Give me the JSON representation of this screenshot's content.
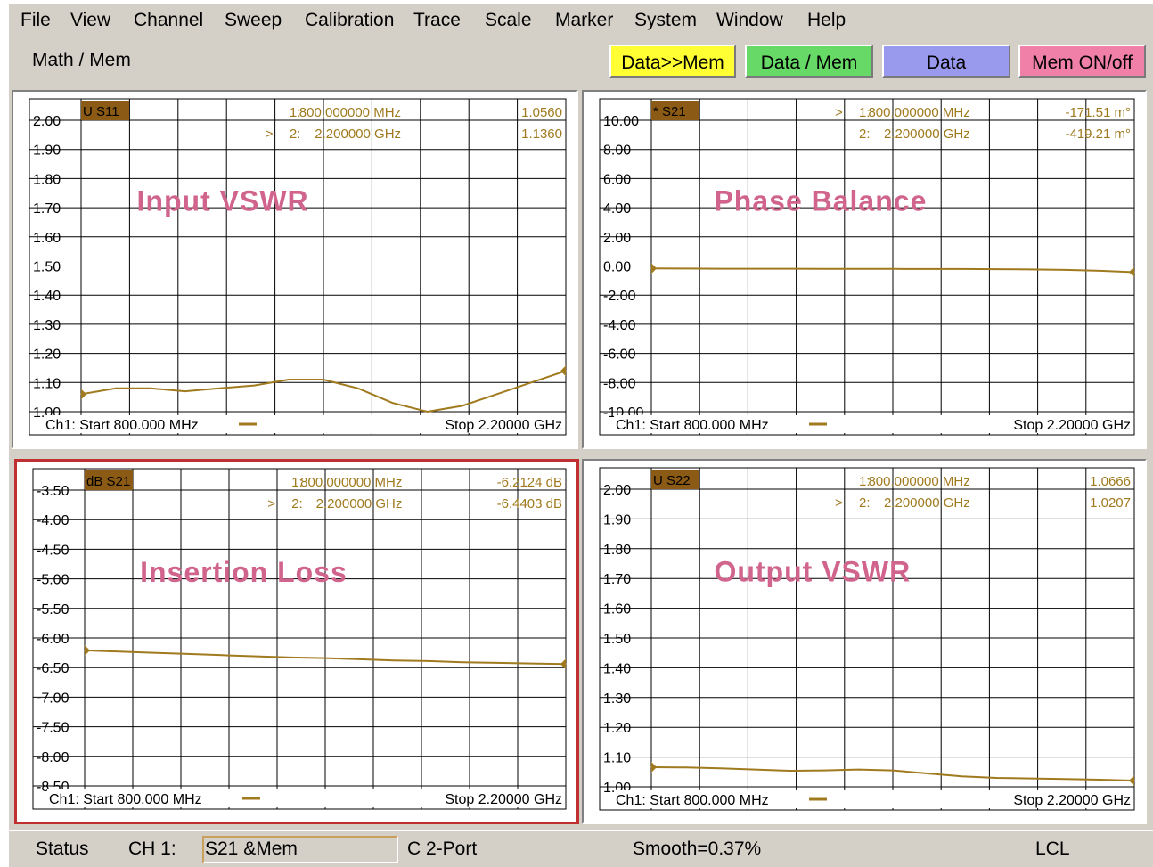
{
  "menu": [
    "File",
    "View",
    "Channel",
    "Sweep",
    "Calibration",
    "Trace",
    "Scale",
    "Marker",
    "System",
    "Window",
    "Help"
  ],
  "toolbar": {
    "title": "Math / Mem",
    "buttons": [
      {
        "label": "Data>>Mem",
        "color": "#ffff33"
      },
      {
        "label": "Data / Mem",
        "color": "#66d966"
      },
      {
        "label": "Data",
        "color": "#9999ee"
      },
      {
        "label": "Mem ON/off",
        "color": "#f080a8"
      }
    ]
  },
  "status": {
    "label": "Status",
    "channel": "CH 1:",
    "trace": "S21 &Mem",
    "port": "C  2-Port",
    "smooth": "Smooth=0.37%",
    "ref": "LCL"
  },
  "colors": {
    "trace": "#a07a1e",
    "grid": "#000000",
    "annotation": "#d0648c",
    "badge": "#8b5a14",
    "active_border": "#c03030"
  },
  "chart_data": [
    {
      "type": "line",
      "title": "Input VSWR",
      "badge": "U S11",
      "y_ticks": [
        "2.00",
        "1.90",
        "1.80",
        "1.70",
        "1.60",
        "1.50",
        "1.40",
        "1.30",
        "1.20",
        "1.10",
        "1.00"
      ],
      "ylim": [
        1.0,
        2.0
      ],
      "x": [
        800,
        900,
        1000,
        1100,
        1200,
        1300,
        1400,
        1500,
        1600,
        1700,
        1800,
        1900,
        2000,
        2100,
        2200
      ],
      "series": [
        {
          "values": [
            1.06,
            1.08,
            1.08,
            1.07,
            1.08,
            1.09,
            1.11,
            1.11,
            1.08,
            1.03,
            1.0,
            1.02,
            1.06,
            1.1,
            1.14
          ]
        }
      ],
      "markers": [
        {
          "label": "1:",
          "freq": "800.000000 MHz",
          "value": "1.0560",
          "active": false
        },
        {
          "label": "2:",
          "freq": "2.200000 GHz",
          "value": "1.1360",
          "active": true
        }
      ],
      "start": "Ch1: Start  800.000 MHz",
      "stop": "Stop  2.20000 GHz",
      "active": false
    },
    {
      "type": "line",
      "title": "Phase Balance",
      "badge": "* S21",
      "y_ticks": [
        "10.00",
        "8.00",
        "6.00",
        "4.00",
        "2.00",
        "0.00",
        "-2.00",
        "-4.00",
        "-6.00",
        "-8.00",
        "-10.00"
      ],
      "ylim": [
        -10.0,
        10.0
      ],
      "x": [
        800,
        900,
        1000,
        1100,
        1200,
        1300,
        1400,
        1500,
        1600,
        1700,
        1800,
        1900,
        2000,
        2100,
        2200
      ],
      "series": [
        {
          "values": [
            -0.17,
            -0.18,
            -0.19,
            -0.19,
            -0.19,
            -0.2,
            -0.2,
            -0.2,
            -0.21,
            -0.21,
            -0.22,
            -0.24,
            -0.27,
            -0.33,
            -0.42
          ]
        }
      ],
      "markers": [
        {
          "label": "1:",
          "freq": "800.000000 MHz",
          "value": "-171.51 m°",
          "active": true
        },
        {
          "label": "2:",
          "freq": "2.200000 GHz",
          "value": "-419.21 m°",
          "active": false
        }
      ],
      "start": "Ch1: Start  800.000 MHz",
      "stop": "Stop  2.20000 GHz",
      "active": false
    },
    {
      "type": "line",
      "title": "Insertion Loss",
      "badge": "dB S21",
      "y_ticks": [
        "-3.50",
        "-4.00",
        "-4.50",
        "-5.00",
        "-5.50",
        "-6.00",
        "-6.50",
        "-7.00",
        "-7.50",
        "-8.00",
        "-8.50"
      ],
      "ylim": [
        -8.6,
        -3.4
      ],
      "x": [
        800,
        900,
        1000,
        1100,
        1200,
        1300,
        1400,
        1500,
        1600,
        1700,
        1800,
        1900,
        2000,
        2100,
        2200
      ],
      "series": [
        {
          "values": [
            -6.21,
            -6.23,
            -6.25,
            -6.27,
            -6.29,
            -6.31,
            -6.33,
            -6.34,
            -6.36,
            -6.38,
            -6.39,
            -6.41,
            -6.42,
            -6.43,
            -6.44
          ]
        }
      ],
      "markers": [
        {
          "label": "1:",
          "freq": "800.000000 MHz",
          "value": "-6.2124 dB",
          "active": false
        },
        {
          "label": "2:",
          "freq": "2.200000 GHz",
          "value": "-6.4403 dB",
          "active": true
        }
      ],
      "start": "Ch1: Start  800.000 MHz",
      "stop": "Stop  2.20000 GHz",
      "active": true
    },
    {
      "type": "line",
      "title": "Output VSWR",
      "badge": "U S22",
      "y_ticks": [
        "2.00",
        "1.90",
        "1.80",
        "1.70",
        "1.60",
        "1.50",
        "1.40",
        "1.30",
        "1.20",
        "1.10",
        "1.00"
      ],
      "ylim": [
        1.0,
        2.0
      ],
      "x": [
        800,
        900,
        1000,
        1100,
        1200,
        1300,
        1400,
        1500,
        1600,
        1700,
        1800,
        1900,
        2000,
        2100,
        2200
      ],
      "series": [
        {
          "values": [
            1.066,
            1.065,
            1.062,
            1.058,
            1.054,
            1.055,
            1.058,
            1.055,
            1.045,
            1.035,
            1.03,
            1.028,
            1.026,
            1.024,
            1.021
          ]
        }
      ],
      "markers": [
        {
          "label": "1:",
          "freq": "800.000000 MHz",
          "value": "1.0666",
          "active": false
        },
        {
          "label": "2:",
          "freq": "2.200000 GHz",
          "value": "1.0207",
          "active": true
        }
      ],
      "start": "Ch1: Start  800.000 MHz",
      "stop": "Stop  2.20000 GHz",
      "active": false
    }
  ]
}
